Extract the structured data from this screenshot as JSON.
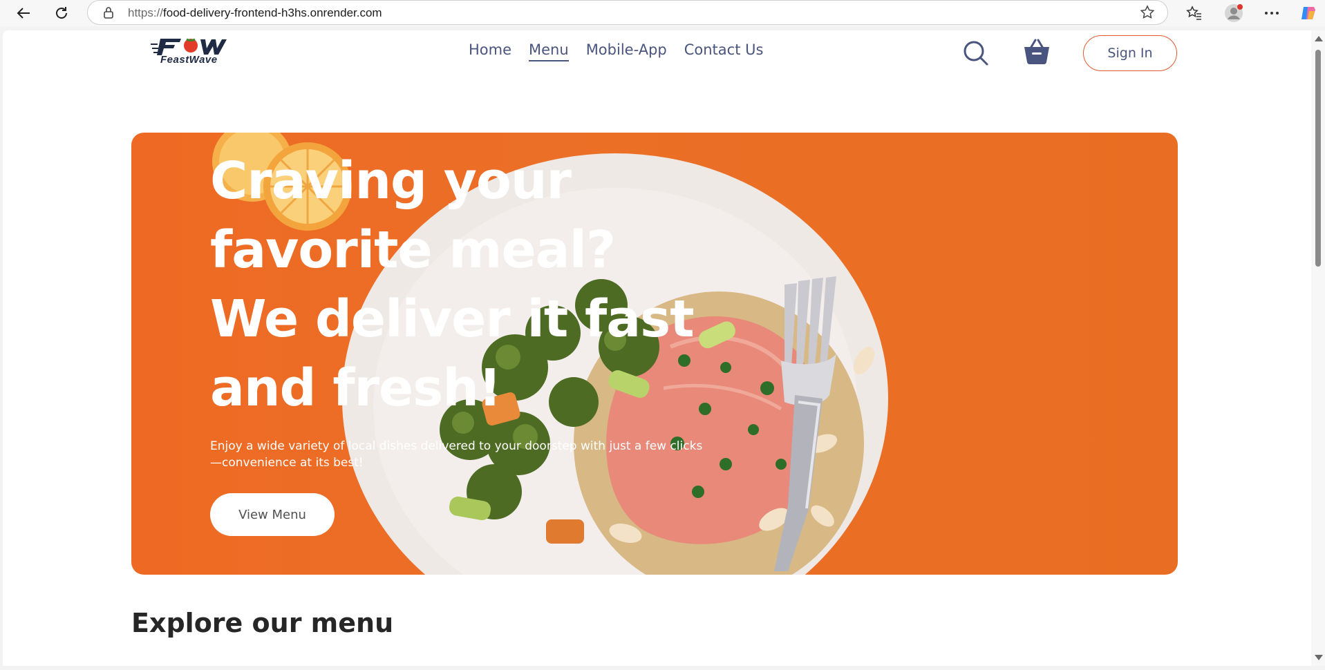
{
  "browser": {
    "url_scheme": "https://",
    "url_host": "food-delivery-frontend-h3hs.onrender.com"
  },
  "site": {
    "logo_mark": "Fow",
    "logo_name": "FeastWave",
    "nav": [
      {
        "label": "Home",
        "active": false
      },
      {
        "label": "Menu",
        "active": true
      },
      {
        "label": "Mobile-App",
        "active": false
      },
      {
        "label": "Contact Us",
        "active": false
      }
    ],
    "signin_label": "Sign In",
    "accent_color": "#e4572e",
    "nav_color": "#49557e"
  },
  "hero": {
    "title": "Craving your favorite meal? We deliver it fast and fresh!",
    "subtitle": "Enjoy a wide variety of local dishes delivered to your doorstep with just a few clicks—convenience at its best!",
    "button_label": "View Menu",
    "background_color": "#ec6f27"
  },
  "explore": {
    "heading": "Explore our menu"
  }
}
